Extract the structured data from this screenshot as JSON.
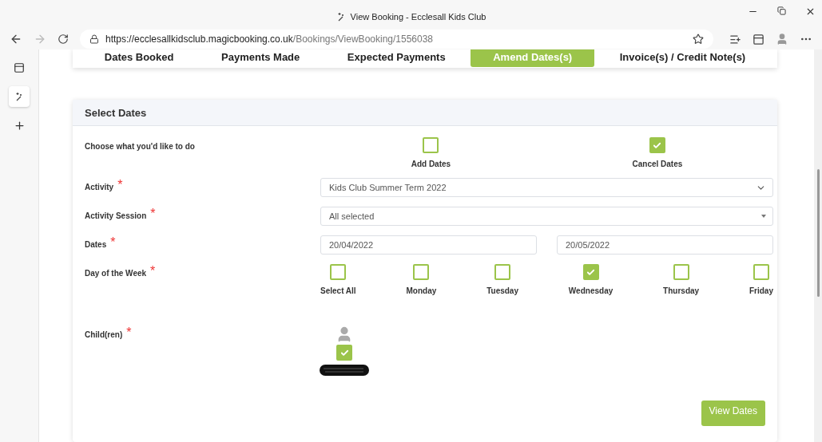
{
  "window": {
    "title": "View Booking - Ecclesall Kids Club"
  },
  "address_bar": {
    "url_host": "https://ecclesallkidsclub.magicbooking.co.uk",
    "url_path": "/Bookings/ViewBooking/1556038"
  },
  "tabs": [
    {
      "label": "Dates Booked",
      "selected": false
    },
    {
      "label": "Payments Made",
      "selected": false
    },
    {
      "label": "Expected Payments",
      "selected": false
    },
    {
      "label": "Amend Dates(s)",
      "selected": true
    },
    {
      "label": "Invoice(s) / Credit Note(s)",
      "selected": false
    }
  ],
  "card": {
    "title": "Select Dates",
    "action_label": "Choose what you'd like to do",
    "actions": [
      {
        "label": "Add Dates",
        "checked": false
      },
      {
        "label": "Cancel Dates",
        "checked": true
      }
    ],
    "activity": {
      "label": "Activity",
      "required": "*",
      "value": "Kids Club Summer Term 2022"
    },
    "session": {
      "label": "Activity Session",
      "required": "*",
      "value": "All selected"
    },
    "dates": {
      "label": "Dates",
      "required": "*",
      "from": "20/04/2022",
      "to": "20/05/2022"
    },
    "days": {
      "label": "Day of the Week",
      "required": "*",
      "options": [
        {
          "label": "Select All",
          "checked": false
        },
        {
          "label": "Monday",
          "checked": false
        },
        {
          "label": "Tuesday",
          "checked": false
        },
        {
          "label": "Wednesday",
          "checked": true
        },
        {
          "label": "Thursday",
          "checked": false
        },
        {
          "label": "Friday",
          "checked": false
        }
      ]
    },
    "children": {
      "label": "Child(ren)",
      "required": "*",
      "items": [
        {
          "checked": true
        }
      ]
    },
    "submit": "View Dates"
  }
}
